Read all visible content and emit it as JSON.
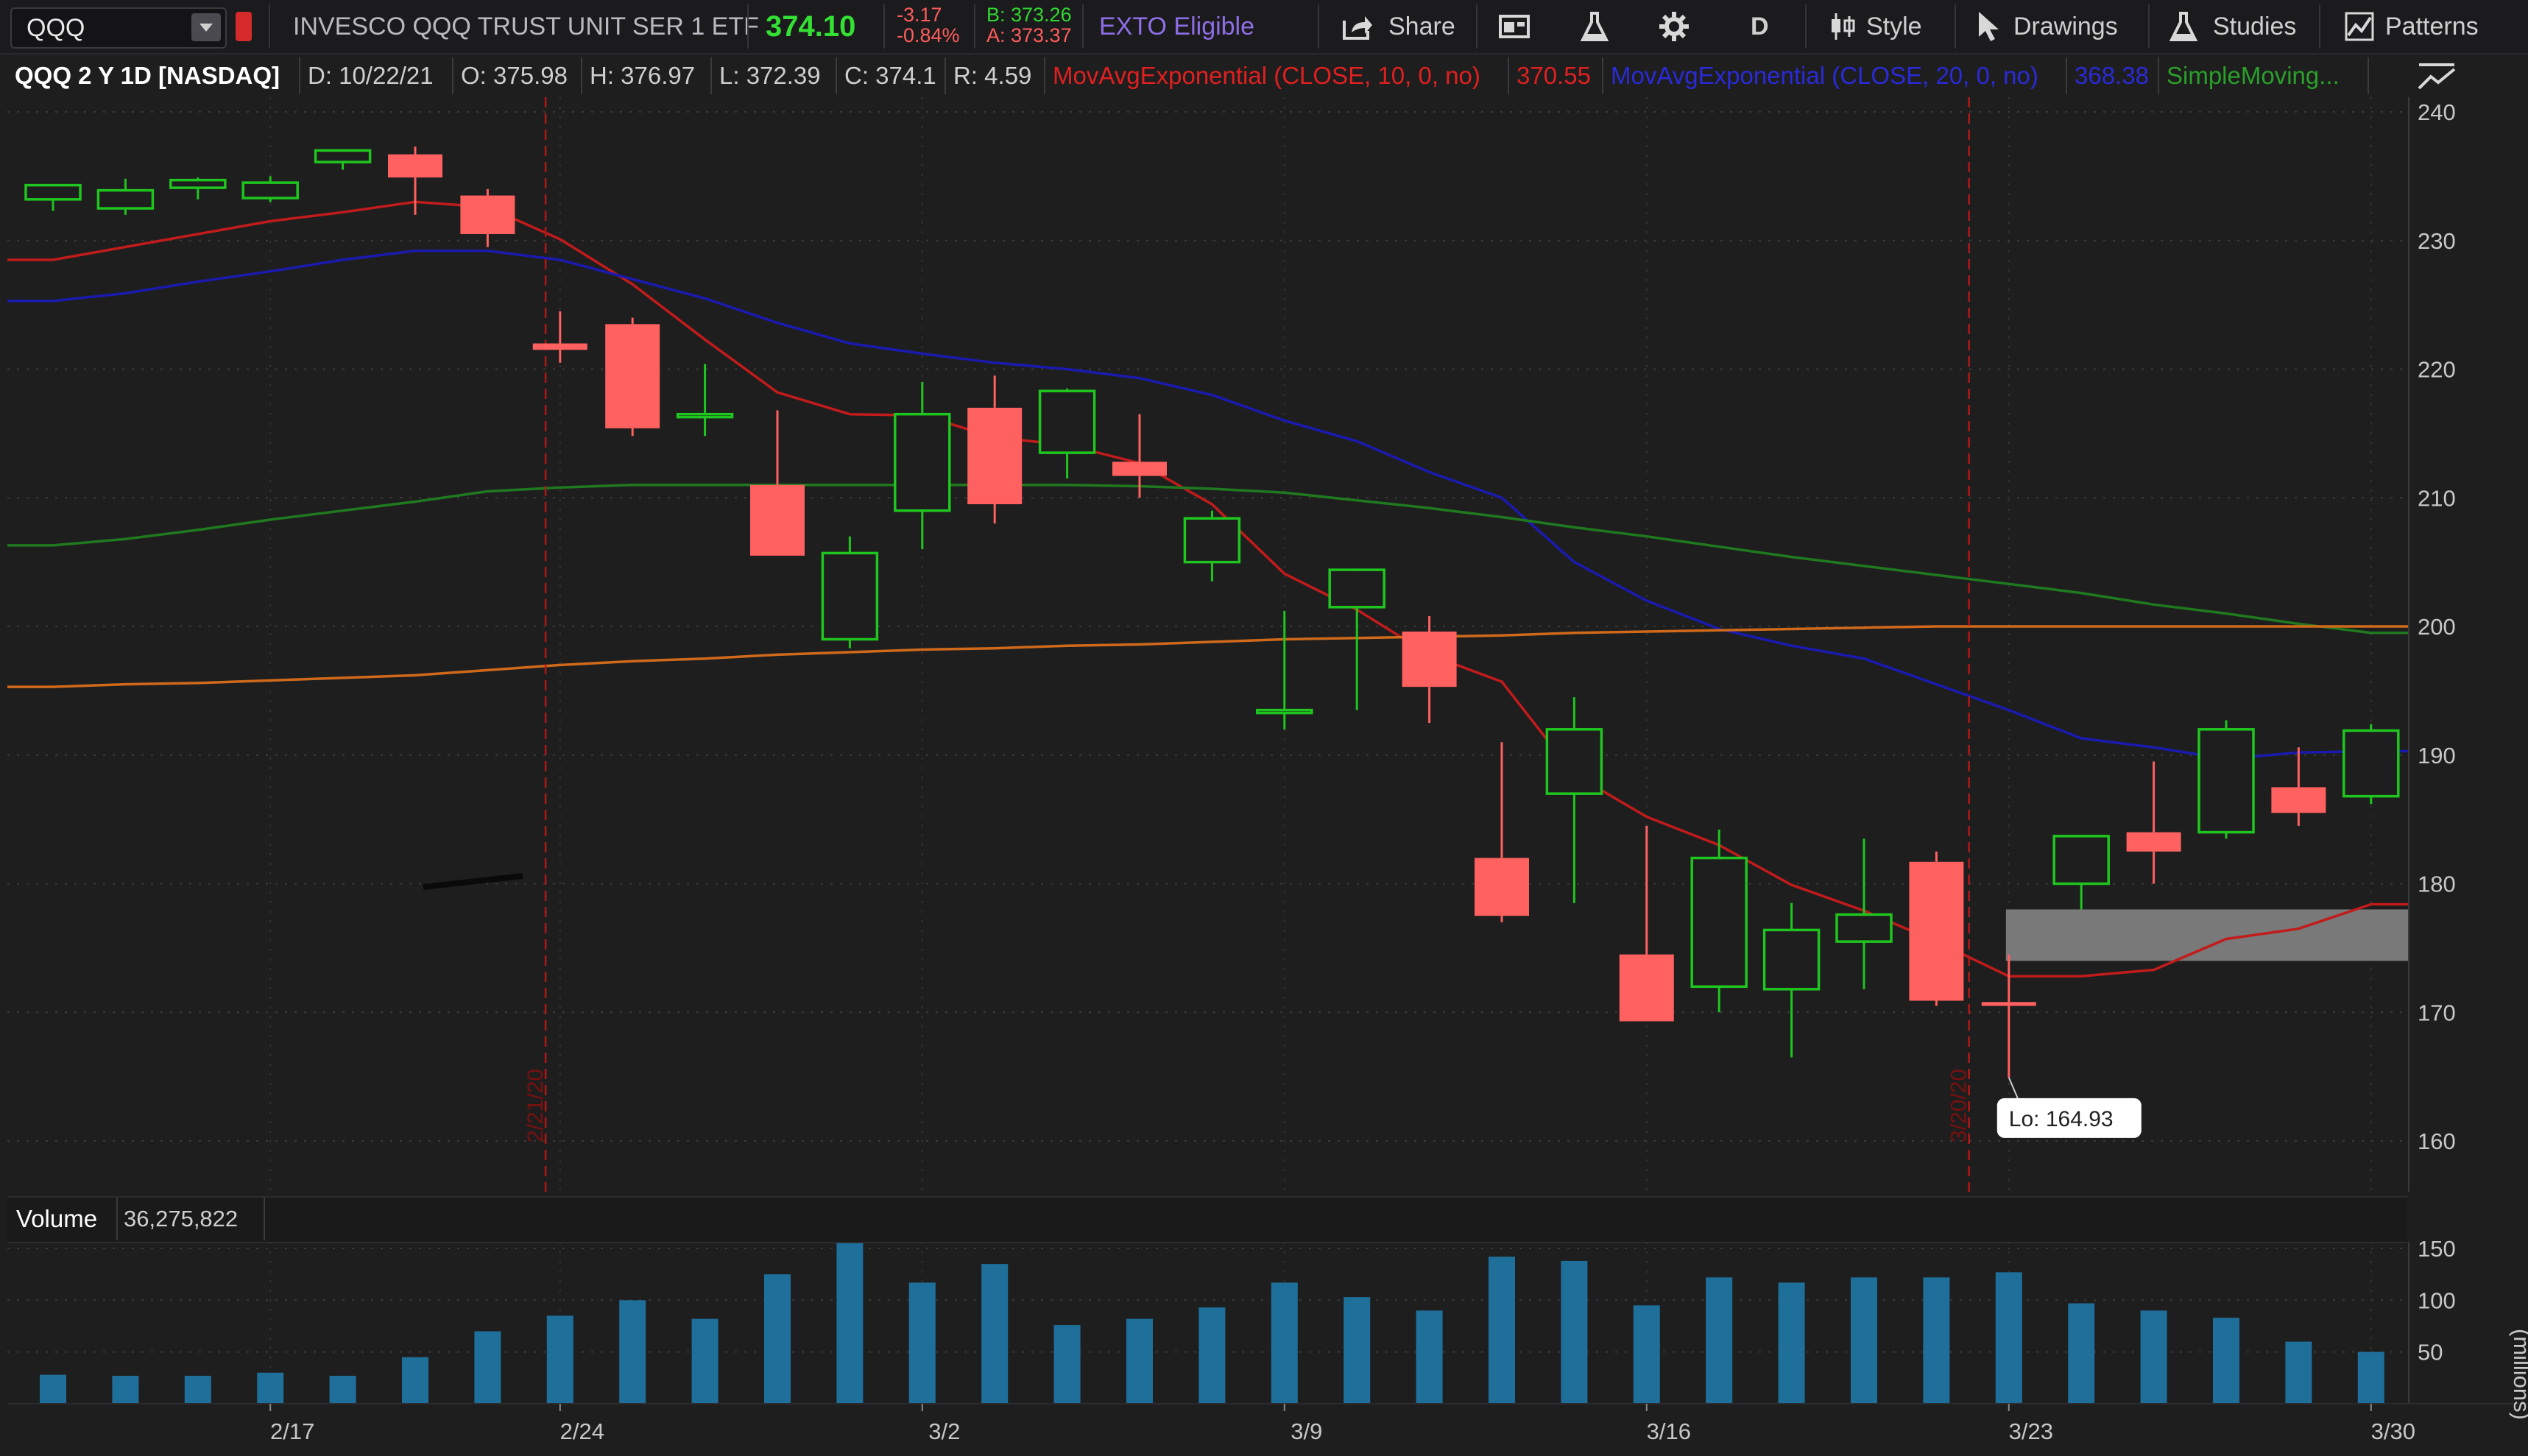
{
  "toolbar": {
    "symbol": "QQQ",
    "security_name": "INVESCO QQQ TRUST UNIT SER 1 ETF",
    "last_price": "374.10",
    "change": "-3.17",
    "change_pct": "-0.84%",
    "bid": "B: 373.26",
    "ask": "A: 373.37",
    "exto": "EXTO Eligible",
    "share": "Share",
    "aggregation": "D",
    "style": "Style",
    "drawings": "Drawings",
    "studies": "Studies",
    "patterns": "Patterns"
  },
  "infobar": {
    "chart_id": "QQQ 2 Y 1D [NASDAQ]",
    "date": "D: 10/22/21",
    "open": "O: 375.98",
    "high": "H: 376.97",
    "low": "L: 372.39",
    "close": "C: 374.1",
    "range": "R: 4.59",
    "ema10_label": "MovAvgExponential (CLOSE, 10, 0, no)",
    "ema10_value": "370.55",
    "ema20_label": "MovAvgExponential (CLOSE, 20, 0, no)",
    "ema20_value": "368.38",
    "sma_label": "SimpleMoving..."
  },
  "volume": {
    "label": "Volume",
    "value": "36,275,822",
    "unit": "(millions)"
  },
  "markers": {
    "low_label": "Lo: 164.93",
    "vline1_date": "2/21/20",
    "vline2_date": "3/20/20"
  },
  "colors": {
    "up": "#1fc61f",
    "down": "#ff6060",
    "ema10": "#c21b1b",
    "ema20": "#1a1ab0",
    "sma_green": "#1f7a1f",
    "sma_orange": "#d06a1a",
    "volume": "#1f6f9b"
  },
  "chart_data": {
    "type": "candlestick",
    "price_axis": {
      "min": 160,
      "max": 240,
      "ticks": [
        160,
        170,
        180,
        190,
        200,
        210,
        220,
        230,
        240
      ]
    },
    "volume_axis": {
      "min": 0,
      "max": 150,
      "ticks": [
        50,
        100,
        150
      ],
      "unit": "millions"
    },
    "x_ticks": [
      "2/17",
      "2/24",
      "3/2",
      "3/9",
      "3/16",
      "3/23",
      "3/30"
    ],
    "x_tick_index": [
      3,
      7,
      12,
      17,
      22,
      27,
      32
    ],
    "candles": [
      {
        "o": 233.2,
        "h": 234.0,
        "l": 232.3,
        "c": 234.3,
        "v": 28
      },
      {
        "o": 232.5,
        "h": 234.8,
        "l": 232.0,
        "c": 233.9,
        "v": 27
      },
      {
        "o": 234.1,
        "h": 234.9,
        "l": 233.2,
        "c": 234.7,
        "v": 27
      },
      {
        "o": 233.3,
        "h": 235.0,
        "l": 233.0,
        "c": 234.5,
        "v": 30
      },
      {
        "o": 236.1,
        "h": 237.0,
        "l": 235.5,
        "c": 237.0,
        "v": 27
      },
      {
        "o": 236.7,
        "h": 237.3,
        "l": 232.0,
        "c": 234.9,
        "v": 45
      },
      {
        "o": 233.5,
        "h": 234.0,
        "l": 229.5,
        "c": 230.5,
        "v": 70
      },
      {
        "o": 222.0,
        "h": 224.5,
        "l": 220.5,
        "c": 221.5,
        "v": 85
      },
      {
        "o": 223.5,
        "h": 224.0,
        "l": 214.8,
        "c": 215.4,
        "v": 100
      },
      {
        "o": 216.5,
        "h": 220.4,
        "l": 214.8,
        "c": 216.5,
        "v": 82
      },
      {
        "o": 211.0,
        "h": 216.8,
        "l": 205.5,
        "c": 205.5,
        "v": 125
      },
      {
        "o": 199.0,
        "h": 207.0,
        "l": 198.3,
        "c": 205.7,
        "v": 155
      },
      {
        "o": 209.0,
        "h": 219.0,
        "l": 206.0,
        "c": 216.5,
        "v": 117
      },
      {
        "o": 217.0,
        "h": 219.5,
        "l": 208.0,
        "c": 209.5,
        "v": 135
      },
      {
        "o": 213.5,
        "h": 218.5,
        "l": 211.5,
        "c": 218.3,
        "v": 76
      },
      {
        "o": 212.8,
        "h": 216.5,
        "l": 210.0,
        "c": 211.7,
        "v": 82
      },
      {
        "o": 205.0,
        "h": 209.0,
        "l": 203.5,
        "c": 208.4,
        "v": 93
      },
      {
        "o": 193.5,
        "h": 201.2,
        "l": 192.0,
        "c": 193.5,
        "v": 117
      },
      {
        "o": 201.5,
        "h": 204.5,
        "l": 193.5,
        "c": 204.4,
        "v": 103
      },
      {
        "o": 199.6,
        "h": 200.8,
        "l": 192.5,
        "c": 195.3,
        "v": 90
      },
      {
        "o": 182.0,
        "h": 191.0,
        "l": 177.0,
        "c": 177.5,
        "v": 142
      },
      {
        "o": 187.0,
        "h": 194.5,
        "l": 178.5,
        "c": 192.0,
        "v": 138
      },
      {
        "o": 174.5,
        "h": 184.5,
        "l": 169.3,
        "c": 169.3,
        "v": 95
      },
      {
        "o": 172.0,
        "h": 184.2,
        "l": 170.0,
        "c": 182.0,
        "v": 122
      },
      {
        "o": 171.8,
        "h": 178.5,
        "l": 166.5,
        "c": 176.4,
        "v": 117
      },
      {
        "o": 175.5,
        "h": 183.5,
        "l": 171.8,
        "c": 177.6,
        "v": 122
      },
      {
        "o": 181.7,
        "h": 182.5,
        "l": 170.5,
        "c": 170.9,
        "v": 122
      },
      {
        "o": 170.8,
        "h": 174.5,
        "l": 164.93,
        "c": 170.5,
        "v": 127
      },
      {
        "o": 180.0,
        "h": 183.7,
        "l": 178.0,
        "c": 183.7,
        "v": 97
      },
      {
        "o": 184.0,
        "h": 189.5,
        "l": 180.0,
        "c": 182.5,
        "v": 90
      },
      {
        "o": 184.0,
        "h": 192.7,
        "l": 183.5,
        "c": 192.0,
        "v": 83
      },
      {
        "o": 187.5,
        "h": 190.6,
        "l": 184.5,
        "c": 185.5,
        "v": 60
      },
      {
        "o": 186.8,
        "h": 192.4,
        "l": 186.2,
        "c": 191.9,
        "v": 50
      }
    ],
    "series": [
      {
        "name": "MovAvgExponential (CLOSE, 10, 0, no)",
        "values": [
          228.5,
          229.5,
          230.5,
          231.5,
          232.2,
          233.0,
          232.6,
          230.1,
          226.6,
          222.3,
          218.2,
          216.5,
          216.4,
          214.7,
          214.1,
          212.7,
          209.5,
          204.1,
          201.3,
          197.8,
          195.7,
          188.5,
          185.2,
          183.0,
          179.9,
          177.9,
          175.5,
          172.8,
          172.8,
          173.3,
          175.7,
          176.5,
          178.4
        ]
      },
      {
        "name": "MovAvgExponential (CLOSE, 20, 0, no)",
        "values": [
          225.3,
          225.9,
          226.8,
          227.6,
          228.5,
          229.2,
          229.2,
          228.5,
          227.0,
          225.5,
          223.6,
          222.0,
          221.2,
          220.5,
          220.0,
          219.3,
          218.0,
          216.0,
          214.4,
          212.0,
          210.0,
          205.0,
          202.0,
          199.8,
          198.5,
          197.5,
          195.5,
          193.5,
          191.3,
          190.6,
          189.7,
          190.2,
          190.3
        ]
      },
      {
        "name": "SimpleMoving",
        "values": [
          206.3,
          206.8,
          207.5,
          208.3,
          209.0,
          209.7,
          210.5,
          210.8,
          211.0,
          211.0,
          211.0,
          211.0,
          211.0,
          211.0,
          211.0,
          210.9,
          210.7,
          210.4,
          209.8,
          209.2,
          208.5,
          207.7,
          207.0,
          206.2,
          205.4,
          204.7,
          204.0,
          203.3,
          202.6,
          201.7,
          201.0,
          200.2,
          199.5
        ]
      },
      {
        "name": "SimpleMoving (orange)",
        "values": [
          195.3,
          195.5,
          195.6,
          195.8,
          196.0,
          196.2,
          196.6,
          197.0,
          197.3,
          197.5,
          197.8,
          198.0,
          198.2,
          198.3,
          198.5,
          198.6,
          198.8,
          199.0,
          199.1,
          199.2,
          199.3,
          199.5,
          199.6,
          199.7,
          199.8,
          199.9,
          200.0,
          200.0,
          200.0,
          200.0,
          200.0,
          200.0,
          200.0
        ]
      }
    ],
    "volume_values_from": "candles.v",
    "zone": {
      "from_index": 27,
      "low": 174.0,
      "high": 178.0
    }
  }
}
